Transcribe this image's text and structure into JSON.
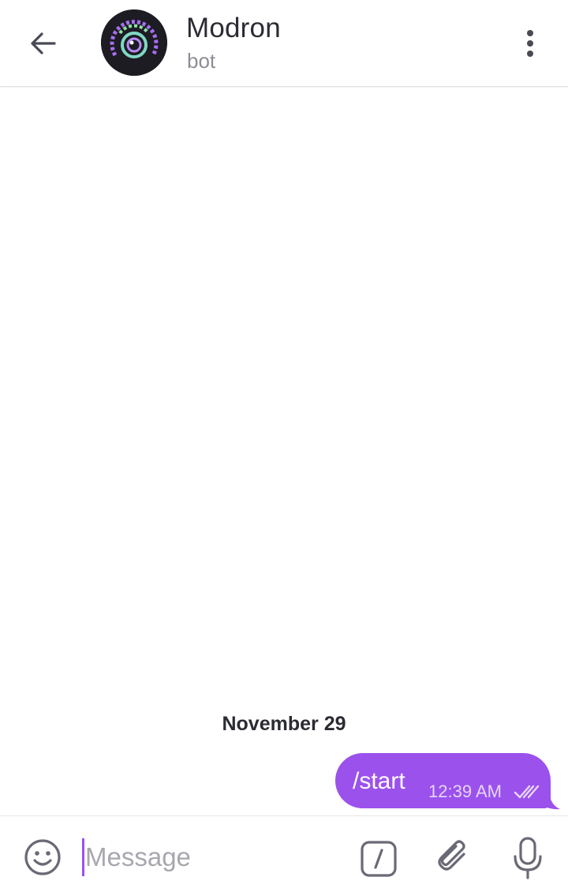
{
  "header": {
    "title": "Modron",
    "subtitle": "bot",
    "back_icon": "arrow-left-icon",
    "menu_icon": "more-vertical-icon",
    "avatar": "bot-avatar-eye-logo"
  },
  "chat": {
    "date_separator": "November 29",
    "messages": [
      {
        "direction": "outgoing",
        "text": "/start",
        "time": "12:39 AM",
        "status": "read",
        "status_icon": "double-check-icon"
      }
    ]
  },
  "input_bar": {
    "placeholder": "Message",
    "value": "",
    "emoji_icon": "smiley-icon",
    "command_icon": "slash-command-icon",
    "attach_icon": "paperclip-icon",
    "mic_icon": "microphone-icon"
  },
  "colors": {
    "accent": "#9b51ec",
    "text_primary": "#2b2b33",
    "text_secondary": "#8d8d95",
    "icon": "#5f5f6b"
  }
}
